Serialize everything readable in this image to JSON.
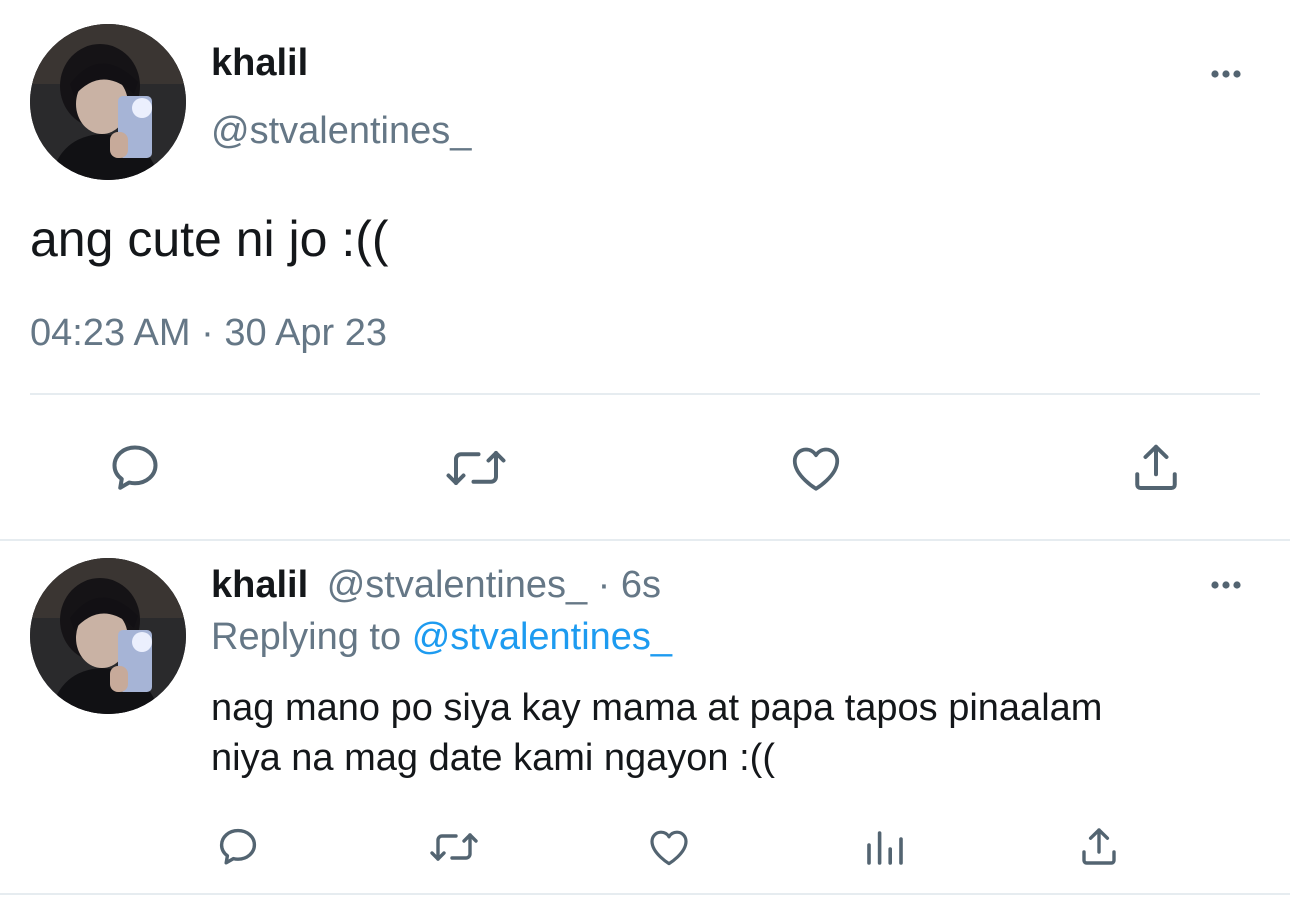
{
  "main_tweet": {
    "display_name": "khalil",
    "handle": "@stvalentines_",
    "text": "ang cute ni jo :((",
    "time": "04:23 AM",
    "separator": "·",
    "date": "30 Apr 23"
  },
  "reply_tweet": {
    "display_name": "khalil",
    "handle": "@stvalentines_",
    "age": "· 6s",
    "replying_prefix": "Replying to",
    "replying_handle": "@stvalentines_",
    "text_line1": "nag mano po siya kay mama at papa tapos pinaalam",
    "text_line2": "niya na mag date kami ngayon :(("
  },
  "icons": {
    "more": "more-horizontal-icon",
    "reply": "reply-bubble-icon",
    "retweet": "retweet-icon",
    "like": "heart-icon",
    "views": "analytics-bars-icon",
    "share": "share-upload-icon"
  },
  "colors": {
    "text": "#14171a",
    "secondary": "#657786",
    "link": "#1d9bf0",
    "divider": "#e6ecf0",
    "icon": "#536471"
  }
}
